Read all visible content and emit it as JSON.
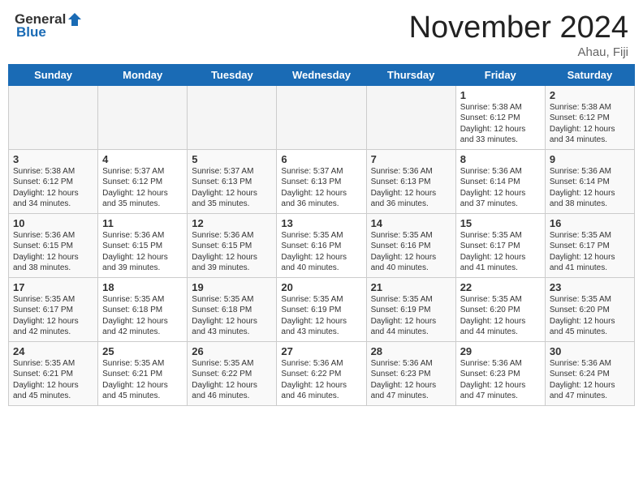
{
  "header": {
    "logo_general": "General",
    "logo_blue": "Blue",
    "month_title": "November 2024",
    "location": "Ahau, Fiji"
  },
  "weekdays": [
    "Sunday",
    "Monday",
    "Tuesday",
    "Wednesday",
    "Thursday",
    "Friday",
    "Saturday"
  ],
  "weeks": [
    [
      {
        "day": "",
        "empty": true
      },
      {
        "day": "",
        "empty": true
      },
      {
        "day": "",
        "empty": true
      },
      {
        "day": "",
        "empty": true
      },
      {
        "day": "",
        "empty": true
      },
      {
        "day": "1",
        "sunrise": "Sunrise: 5:38 AM",
        "sunset": "Sunset: 6:12 PM",
        "daylight": "Daylight: 12 hours and 33 minutes."
      },
      {
        "day": "2",
        "sunrise": "Sunrise: 5:38 AM",
        "sunset": "Sunset: 6:12 PM",
        "daylight": "Daylight: 12 hours and 34 minutes."
      }
    ],
    [
      {
        "day": "3",
        "sunrise": "Sunrise: 5:38 AM",
        "sunset": "Sunset: 6:12 PM",
        "daylight": "Daylight: 12 hours and 34 minutes."
      },
      {
        "day": "4",
        "sunrise": "Sunrise: 5:37 AM",
        "sunset": "Sunset: 6:12 PM",
        "daylight": "Daylight: 12 hours and 35 minutes."
      },
      {
        "day": "5",
        "sunrise": "Sunrise: 5:37 AM",
        "sunset": "Sunset: 6:13 PM",
        "daylight": "Daylight: 12 hours and 35 minutes."
      },
      {
        "day": "6",
        "sunrise": "Sunrise: 5:37 AM",
        "sunset": "Sunset: 6:13 PM",
        "daylight": "Daylight: 12 hours and 36 minutes."
      },
      {
        "day": "7",
        "sunrise": "Sunrise: 5:36 AM",
        "sunset": "Sunset: 6:13 PM",
        "daylight": "Daylight: 12 hours and 36 minutes."
      },
      {
        "day": "8",
        "sunrise": "Sunrise: 5:36 AM",
        "sunset": "Sunset: 6:14 PM",
        "daylight": "Daylight: 12 hours and 37 minutes."
      },
      {
        "day": "9",
        "sunrise": "Sunrise: 5:36 AM",
        "sunset": "Sunset: 6:14 PM",
        "daylight": "Daylight: 12 hours and 38 minutes."
      }
    ],
    [
      {
        "day": "10",
        "sunrise": "Sunrise: 5:36 AM",
        "sunset": "Sunset: 6:15 PM",
        "daylight": "Daylight: 12 hours and 38 minutes."
      },
      {
        "day": "11",
        "sunrise": "Sunrise: 5:36 AM",
        "sunset": "Sunset: 6:15 PM",
        "daylight": "Daylight: 12 hours and 39 minutes."
      },
      {
        "day": "12",
        "sunrise": "Sunrise: 5:36 AM",
        "sunset": "Sunset: 6:15 PM",
        "daylight": "Daylight: 12 hours and 39 minutes."
      },
      {
        "day": "13",
        "sunrise": "Sunrise: 5:35 AM",
        "sunset": "Sunset: 6:16 PM",
        "daylight": "Daylight: 12 hours and 40 minutes."
      },
      {
        "day": "14",
        "sunrise": "Sunrise: 5:35 AM",
        "sunset": "Sunset: 6:16 PM",
        "daylight": "Daylight: 12 hours and 40 minutes."
      },
      {
        "day": "15",
        "sunrise": "Sunrise: 5:35 AM",
        "sunset": "Sunset: 6:17 PM",
        "daylight": "Daylight: 12 hours and 41 minutes."
      },
      {
        "day": "16",
        "sunrise": "Sunrise: 5:35 AM",
        "sunset": "Sunset: 6:17 PM",
        "daylight": "Daylight: 12 hours and 41 minutes."
      }
    ],
    [
      {
        "day": "17",
        "sunrise": "Sunrise: 5:35 AM",
        "sunset": "Sunset: 6:17 PM",
        "daylight": "Daylight: 12 hours and 42 minutes."
      },
      {
        "day": "18",
        "sunrise": "Sunrise: 5:35 AM",
        "sunset": "Sunset: 6:18 PM",
        "daylight": "Daylight: 12 hours and 42 minutes."
      },
      {
        "day": "19",
        "sunrise": "Sunrise: 5:35 AM",
        "sunset": "Sunset: 6:18 PM",
        "daylight": "Daylight: 12 hours and 43 minutes."
      },
      {
        "day": "20",
        "sunrise": "Sunrise: 5:35 AM",
        "sunset": "Sunset: 6:19 PM",
        "daylight": "Daylight: 12 hours and 43 minutes."
      },
      {
        "day": "21",
        "sunrise": "Sunrise: 5:35 AM",
        "sunset": "Sunset: 6:19 PM",
        "daylight": "Daylight: 12 hours and 44 minutes."
      },
      {
        "day": "22",
        "sunrise": "Sunrise: 5:35 AM",
        "sunset": "Sunset: 6:20 PM",
        "daylight": "Daylight: 12 hours and 44 minutes."
      },
      {
        "day": "23",
        "sunrise": "Sunrise: 5:35 AM",
        "sunset": "Sunset: 6:20 PM",
        "daylight": "Daylight: 12 hours and 45 minutes."
      }
    ],
    [
      {
        "day": "24",
        "sunrise": "Sunrise: 5:35 AM",
        "sunset": "Sunset: 6:21 PM",
        "daylight": "Daylight: 12 hours and 45 minutes."
      },
      {
        "day": "25",
        "sunrise": "Sunrise: 5:35 AM",
        "sunset": "Sunset: 6:21 PM",
        "daylight": "Daylight: 12 hours and 45 minutes."
      },
      {
        "day": "26",
        "sunrise": "Sunrise: 5:35 AM",
        "sunset": "Sunset: 6:22 PM",
        "daylight": "Daylight: 12 hours and 46 minutes."
      },
      {
        "day": "27",
        "sunrise": "Sunrise: 5:36 AM",
        "sunset": "Sunset: 6:22 PM",
        "daylight": "Daylight: 12 hours and 46 minutes."
      },
      {
        "day": "28",
        "sunrise": "Sunrise: 5:36 AM",
        "sunset": "Sunset: 6:23 PM",
        "daylight": "Daylight: 12 hours and 47 minutes."
      },
      {
        "day": "29",
        "sunrise": "Sunrise: 5:36 AM",
        "sunset": "Sunset: 6:23 PM",
        "daylight": "Daylight: 12 hours and 47 minutes."
      },
      {
        "day": "30",
        "sunrise": "Sunrise: 5:36 AM",
        "sunset": "Sunset: 6:24 PM",
        "daylight": "Daylight: 12 hours and 47 minutes."
      }
    ]
  ]
}
